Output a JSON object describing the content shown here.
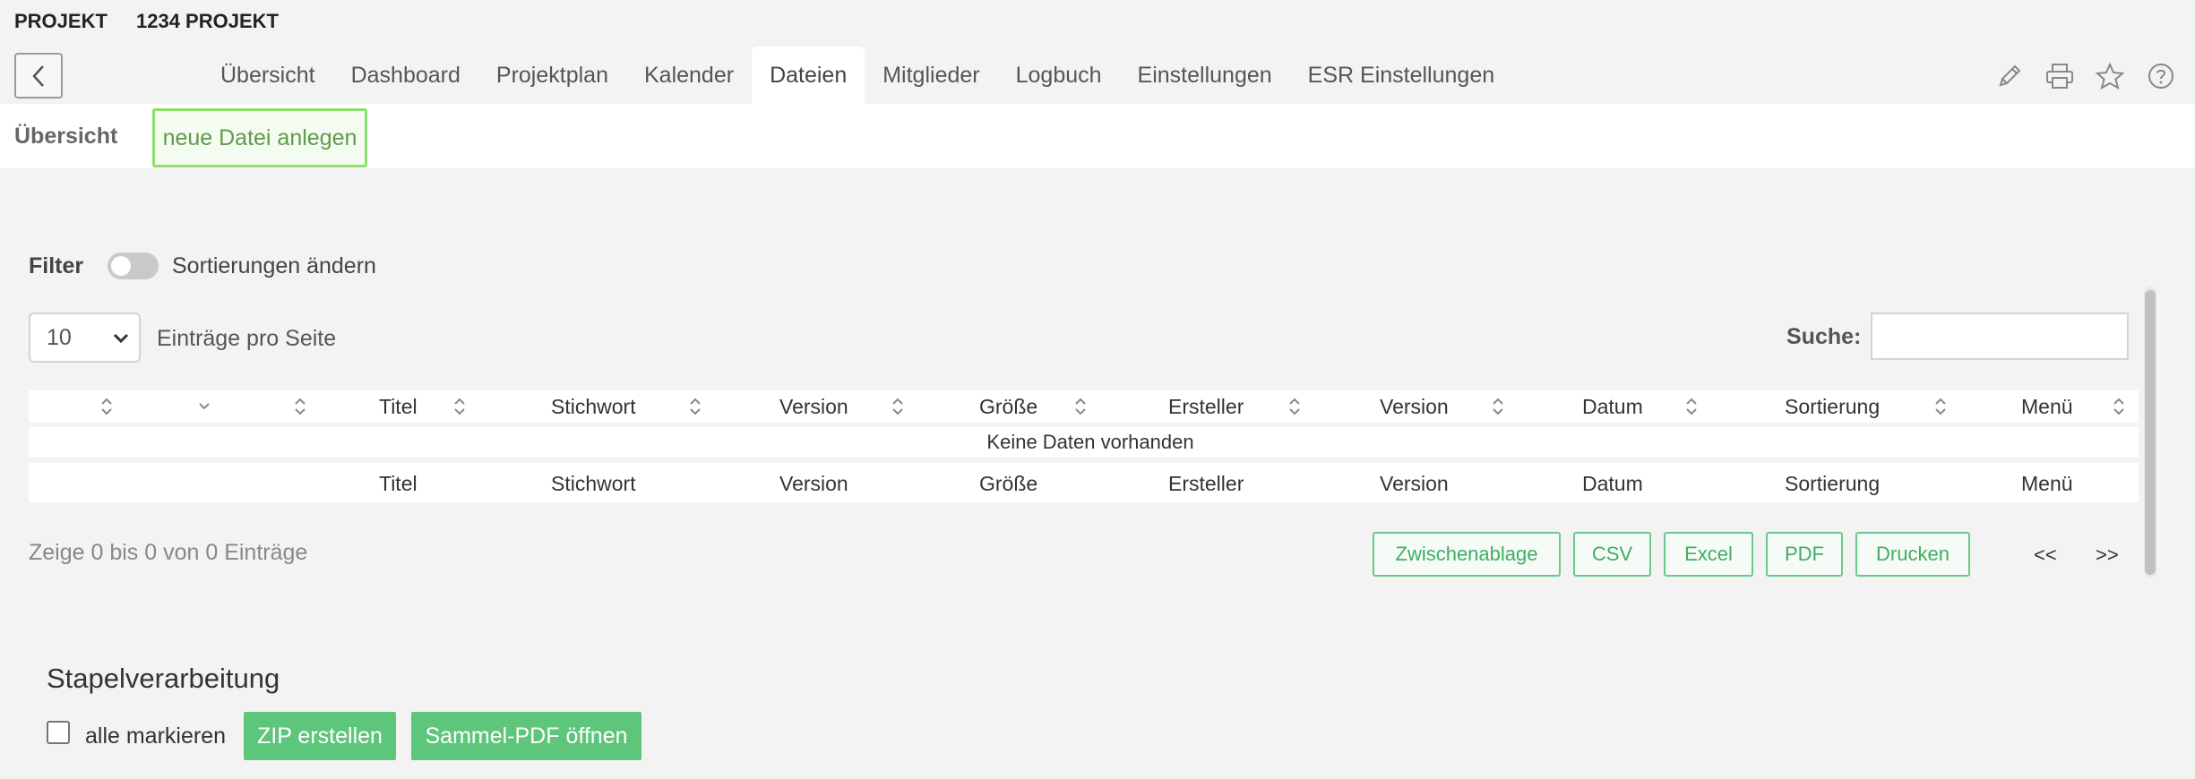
{
  "header": {
    "project_label": "PROJEKT",
    "project_name": "1234 PROJEKT"
  },
  "tabs": [
    {
      "label": "Übersicht",
      "active": false
    },
    {
      "label": "Dashboard",
      "active": false
    },
    {
      "label": "Projektplan",
      "active": false
    },
    {
      "label": "Kalender",
      "active": false
    },
    {
      "label": "Dateien",
      "active": true
    },
    {
      "label": "Mitglieder",
      "active": false
    },
    {
      "label": "Logbuch",
      "active": false
    },
    {
      "label": "Einstellungen",
      "active": false
    },
    {
      "label": "ESR Einstellungen",
      "active": false
    }
  ],
  "toolbar_icons": [
    "pencil-icon",
    "printer-icon",
    "star-icon",
    "help-icon"
  ],
  "subnav": {
    "title": "Übersicht",
    "new_file_label": "neue Datei anlegen"
  },
  "filter": {
    "label": "Filter",
    "toggle_label": "Sortierungen ändern",
    "toggle_on": false
  },
  "table_controls": {
    "page_length": "10",
    "page_length_label": "Einträge pro Seite",
    "search_label": "Suche:",
    "search_value": ""
  },
  "table": {
    "columns": [
      "Titel",
      "Stichwort",
      "Version",
      "Größe",
      "Ersteller",
      "Version",
      "Datum",
      "Sortierung",
      "Menü"
    ],
    "empty_message": "Keine Daten vorhanden",
    "info": "Zeige 0 bis 0 von 0 Einträge"
  },
  "export_buttons": [
    "Zwischenablage",
    "CSV",
    "Excel",
    "PDF",
    "Drucken"
  ],
  "pagination": {
    "prev": "<<",
    "next": ">>"
  },
  "batch": {
    "title": "Stapelverarbeitung",
    "select_all_label": "alle markieren",
    "zip_label": "ZIP erstellen",
    "pdf_label": "Sammel-PDF öffnen"
  },
  "colors": {
    "accent_green": "#5ec67b",
    "highlight_border": "#8ae06a",
    "export_border": "#6ac98a"
  }
}
